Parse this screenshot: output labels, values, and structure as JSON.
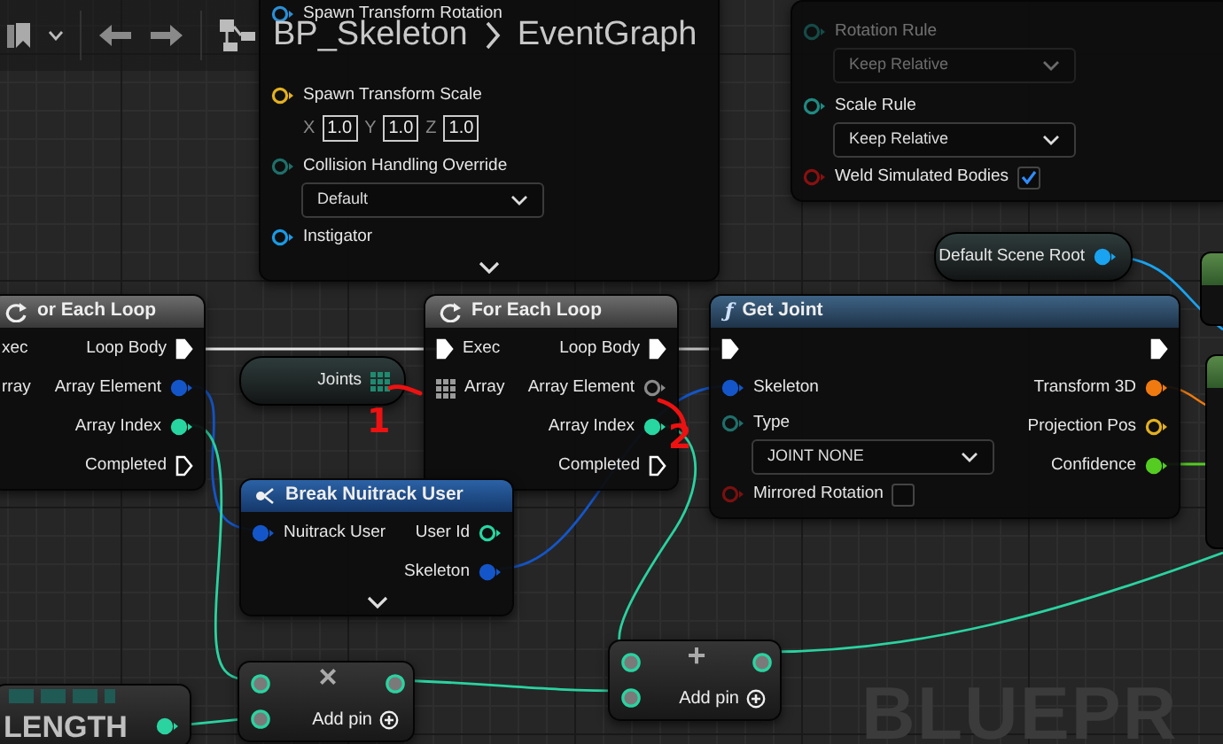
{
  "toolbar": {
    "breadcrumb": [
      "BP_Skeleton",
      "EventGraph"
    ]
  },
  "nodes": [
    {
      "kind": "panel",
      "inputs": [
        {
          "kind": "data",
          "label": "Spawn Transform Rotation",
          "color": "#2b8fd6",
          "connected": false
        },
        {
          "kind": "vector",
          "label": "Spawn Transform Scale",
          "color": "#e3b020",
          "connected": false,
          "fields": [
            {
              "axis": "X",
              "value": "1.0"
            },
            {
              "axis": "Y",
              "value": "1.0"
            },
            {
              "axis": "Z",
              "value": "1.0"
            }
          ]
        },
        {
          "kind": "dropdown",
          "label": "Collision Handling Override",
          "color": "#1f6f6a",
          "connected": false,
          "value": "Default",
          "disabled": false
        },
        {
          "kind": "data",
          "label": "Instigator",
          "color": "#1a9be6",
          "connected": false
        }
      ],
      "advanced_collapsed": true
    },
    {
      "kind": "panel",
      "inputs": [
        {
          "kind": "dropdown",
          "label": "Rotation Rule",
          "color": "#164a47",
          "connected": false,
          "value": "Keep Relative",
          "disabled": true
        },
        {
          "kind": "dropdown",
          "label": "Scale Rule",
          "color": "#1f8a82",
          "connected": false,
          "value": "Keep Relative",
          "disabled": false
        },
        {
          "kind": "checkbox",
          "label": "Weld Simulated Bodies",
          "color": "#8a1010",
          "connected": false,
          "checked": true
        }
      ]
    },
    {
      "kind": "pill",
      "outputs": [
        {
          "kind": "data",
          "label": "Default Scene Root",
          "color": "#19a3f0",
          "connected": true
        }
      ]
    },
    {
      "kind": "loop",
      "title": "or Each Loop",
      "inputs": [
        {
          "kind": "cut",
          "label": "xec"
        },
        {
          "kind": "cut",
          "label": "rray"
        }
      ],
      "outputs": [
        {
          "kind": "exec",
          "label": "Loop Body",
          "connected": true
        },
        {
          "kind": "data",
          "label": "Array Element",
          "color": "#1456c9",
          "connected": true
        },
        {
          "kind": "data",
          "label": "Array Index",
          "color": "#27d6a0",
          "connected": true
        },
        {
          "kind": "exec",
          "label": "Completed",
          "connected": false
        }
      ]
    },
    {
      "kind": "pill",
      "outputs": [
        {
          "kind": "array",
          "label": "Joints",
          "color": "#1e8a70"
        }
      ]
    },
    {
      "kind": "loop",
      "title": "For Each Loop",
      "inputs": [
        {
          "kind": "exec",
          "label": "Exec",
          "connected": true
        },
        {
          "kind": "array",
          "label": "Array",
          "color": "#9a9a9a"
        }
      ],
      "outputs": [
        {
          "kind": "exec",
          "label": "Loop Body",
          "connected": true
        },
        {
          "kind": "data",
          "label": "Array Element",
          "color": "#8a8a8a",
          "connected": false
        },
        {
          "kind": "data",
          "label": "Array Index",
          "color": "#27d6a0",
          "connected": true
        },
        {
          "kind": "exec",
          "label": "Completed",
          "connected": false
        }
      ]
    },
    {
      "kind": "function",
      "icon": "ƒ",
      "title": "Get Joint",
      "inputs": [
        {
          "kind": "exec",
          "connected": true
        },
        {
          "kind": "data",
          "label": "Skeleton",
          "color": "#1456c9",
          "connected": true
        },
        {
          "kind": "dropdown",
          "label": "Type",
          "color": "#1f6f6a",
          "connected": false,
          "value": "JOINT NONE",
          "disabled": false
        },
        {
          "kind": "checkbox",
          "label": "Mirrored Rotation",
          "color": "#7a1010",
          "connected": false,
          "checked": false
        }
      ],
      "outputs": [
        {
          "kind": "exec",
          "connected": true
        },
        {
          "kind": "data",
          "label": "Transform 3D",
          "color": "#f07a10",
          "connected": true
        },
        {
          "kind": "data",
          "label": "Projection Pos",
          "color": "#e3b020",
          "connected": false
        },
        {
          "kind": "data",
          "label": "Confidence",
          "color": "#55cc22",
          "connected": true
        }
      ]
    },
    {
      "kind": "struct",
      "title": "Break Nuitrack User",
      "inputs": [
        {
          "kind": "data",
          "label": "Nuitrack User",
          "color": "#1456c9",
          "connected": true
        }
      ],
      "outputs": [
        {
          "kind": "data",
          "label": "User Id",
          "color": "#27d6a0",
          "connected": false
        },
        {
          "kind": "data",
          "label": "Skeleton",
          "color": "#1456c9",
          "connected": true
        }
      ],
      "advanced_collapsed": true
    },
    {
      "kind": "literal",
      "title": "LENGTH",
      "outputs": [
        {
          "kind": "data",
          "color": "#2ad3a0",
          "connected": true
        }
      ]
    },
    {
      "kind": "math",
      "symbol": "×",
      "add_pin": "Add pin",
      "inputs": [
        {
          "kind": "wildcard",
          "color": "#2ad3a0"
        },
        {
          "kind": "wildcard",
          "color": "#2ad3a0"
        }
      ],
      "outputs": [
        {
          "kind": "wildcard",
          "color": "#2ad3a0"
        }
      ]
    },
    {
      "kind": "math",
      "symbol": "+",
      "add_pin": "Add pin",
      "inputs": [
        {
          "kind": "wildcard",
          "color": "#2ad3a0"
        },
        {
          "kind": "wildcard",
          "color": "#2ad3a0"
        }
      ],
      "outputs": [
        {
          "kind": "wildcard",
          "color": "#2ad3a0"
        }
      ]
    }
  ],
  "annotations": [
    {
      "label": "1"
    },
    {
      "label": "2"
    }
  ],
  "graph_watermark": "BLUEPR"
}
